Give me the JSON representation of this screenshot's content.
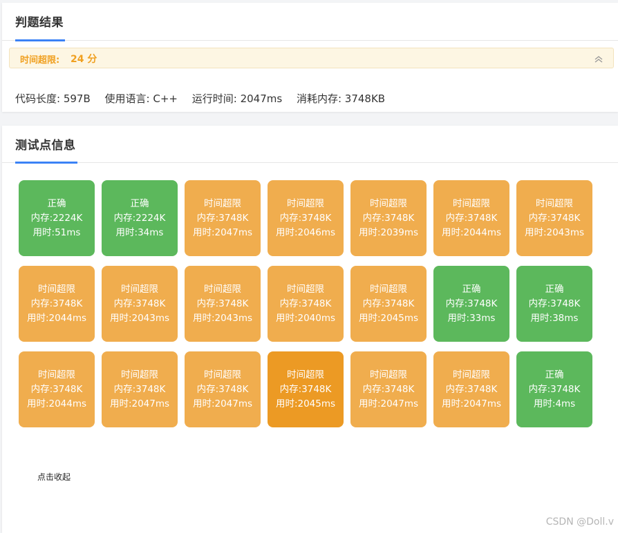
{
  "result_panel": {
    "title": "判题结果",
    "status_label": "时间超限:",
    "score": "24 分",
    "code_length": "代码长度: 597B",
    "language": "使用语言: C++",
    "run_time": "运行时间: 2047ms",
    "memory": "消耗内存: 3748KB"
  },
  "tests_panel": {
    "title": "测试点信息",
    "collapse_label": "点击收起"
  },
  "colors": {
    "accepted": "#5cb85c",
    "time_limit": "#f0ad4e",
    "time_limit_highlight": "#ec9a24",
    "tab_underline": "#3b82f6"
  },
  "test_cases": [
    {
      "status": "正确",
      "memory": "内存:2224K",
      "time": "用时:51ms",
      "kind": "accepted"
    },
    {
      "status": "正确",
      "memory": "内存:2224K",
      "time": "用时:34ms",
      "kind": "accepted"
    },
    {
      "status": "时间超限",
      "memory": "内存:3748K",
      "time": "用时:2047ms",
      "kind": "time_limit"
    },
    {
      "status": "时间超限",
      "memory": "内存:3748K",
      "time": "用时:2046ms",
      "kind": "time_limit"
    },
    {
      "status": "时间超限",
      "memory": "内存:3748K",
      "time": "用时:2039ms",
      "kind": "time_limit"
    },
    {
      "status": "时间超限",
      "memory": "内存:3748K",
      "time": "用时:2044ms",
      "kind": "time_limit"
    },
    {
      "status": "时间超限",
      "memory": "内存:3748K",
      "time": "用时:2043ms",
      "kind": "time_limit"
    },
    {
      "status": "时间超限",
      "memory": "内存:3748K",
      "time": "用时:2044ms",
      "kind": "time_limit"
    },
    {
      "status": "时间超限",
      "memory": "内存:3748K",
      "time": "用时:2043ms",
      "kind": "time_limit"
    },
    {
      "status": "时间超限",
      "memory": "内存:3748K",
      "time": "用时:2043ms",
      "kind": "time_limit"
    },
    {
      "status": "时间超限",
      "memory": "内存:3748K",
      "time": "用时:2040ms",
      "kind": "time_limit"
    },
    {
      "status": "时间超限",
      "memory": "内存:3748K",
      "time": "用时:2045ms",
      "kind": "time_limit"
    },
    {
      "status": "正确",
      "memory": "内存:3748K",
      "time": "用时:33ms",
      "kind": "accepted"
    },
    {
      "status": "正确",
      "memory": "内存:3748K",
      "time": "用时:38ms",
      "kind": "accepted"
    },
    {
      "status": "时间超限",
      "memory": "内存:3748K",
      "time": "用时:2044ms",
      "kind": "time_limit"
    },
    {
      "status": "时间超限",
      "memory": "内存:3748K",
      "time": "用时:2047ms",
      "kind": "time_limit"
    },
    {
      "status": "时间超限",
      "memory": "内存:3748K",
      "time": "用时:2047ms",
      "kind": "time_limit"
    },
    {
      "status": "时间超限",
      "memory": "内存:3748K",
      "time": "用时:2045ms",
      "kind": "time_limit_highlight"
    },
    {
      "status": "时间超限",
      "memory": "内存:3748K",
      "time": "用时:2047ms",
      "kind": "time_limit"
    },
    {
      "status": "时间超限",
      "memory": "内存:3748K",
      "time": "用时:2047ms",
      "kind": "time_limit"
    },
    {
      "status": "正确",
      "memory": "内存:3748K",
      "time": "用时:4ms",
      "kind": "accepted"
    }
  ],
  "watermark": "CSDN @Doll.v",
  "icons": {
    "collapse": "double-chevron-up-icon"
  }
}
